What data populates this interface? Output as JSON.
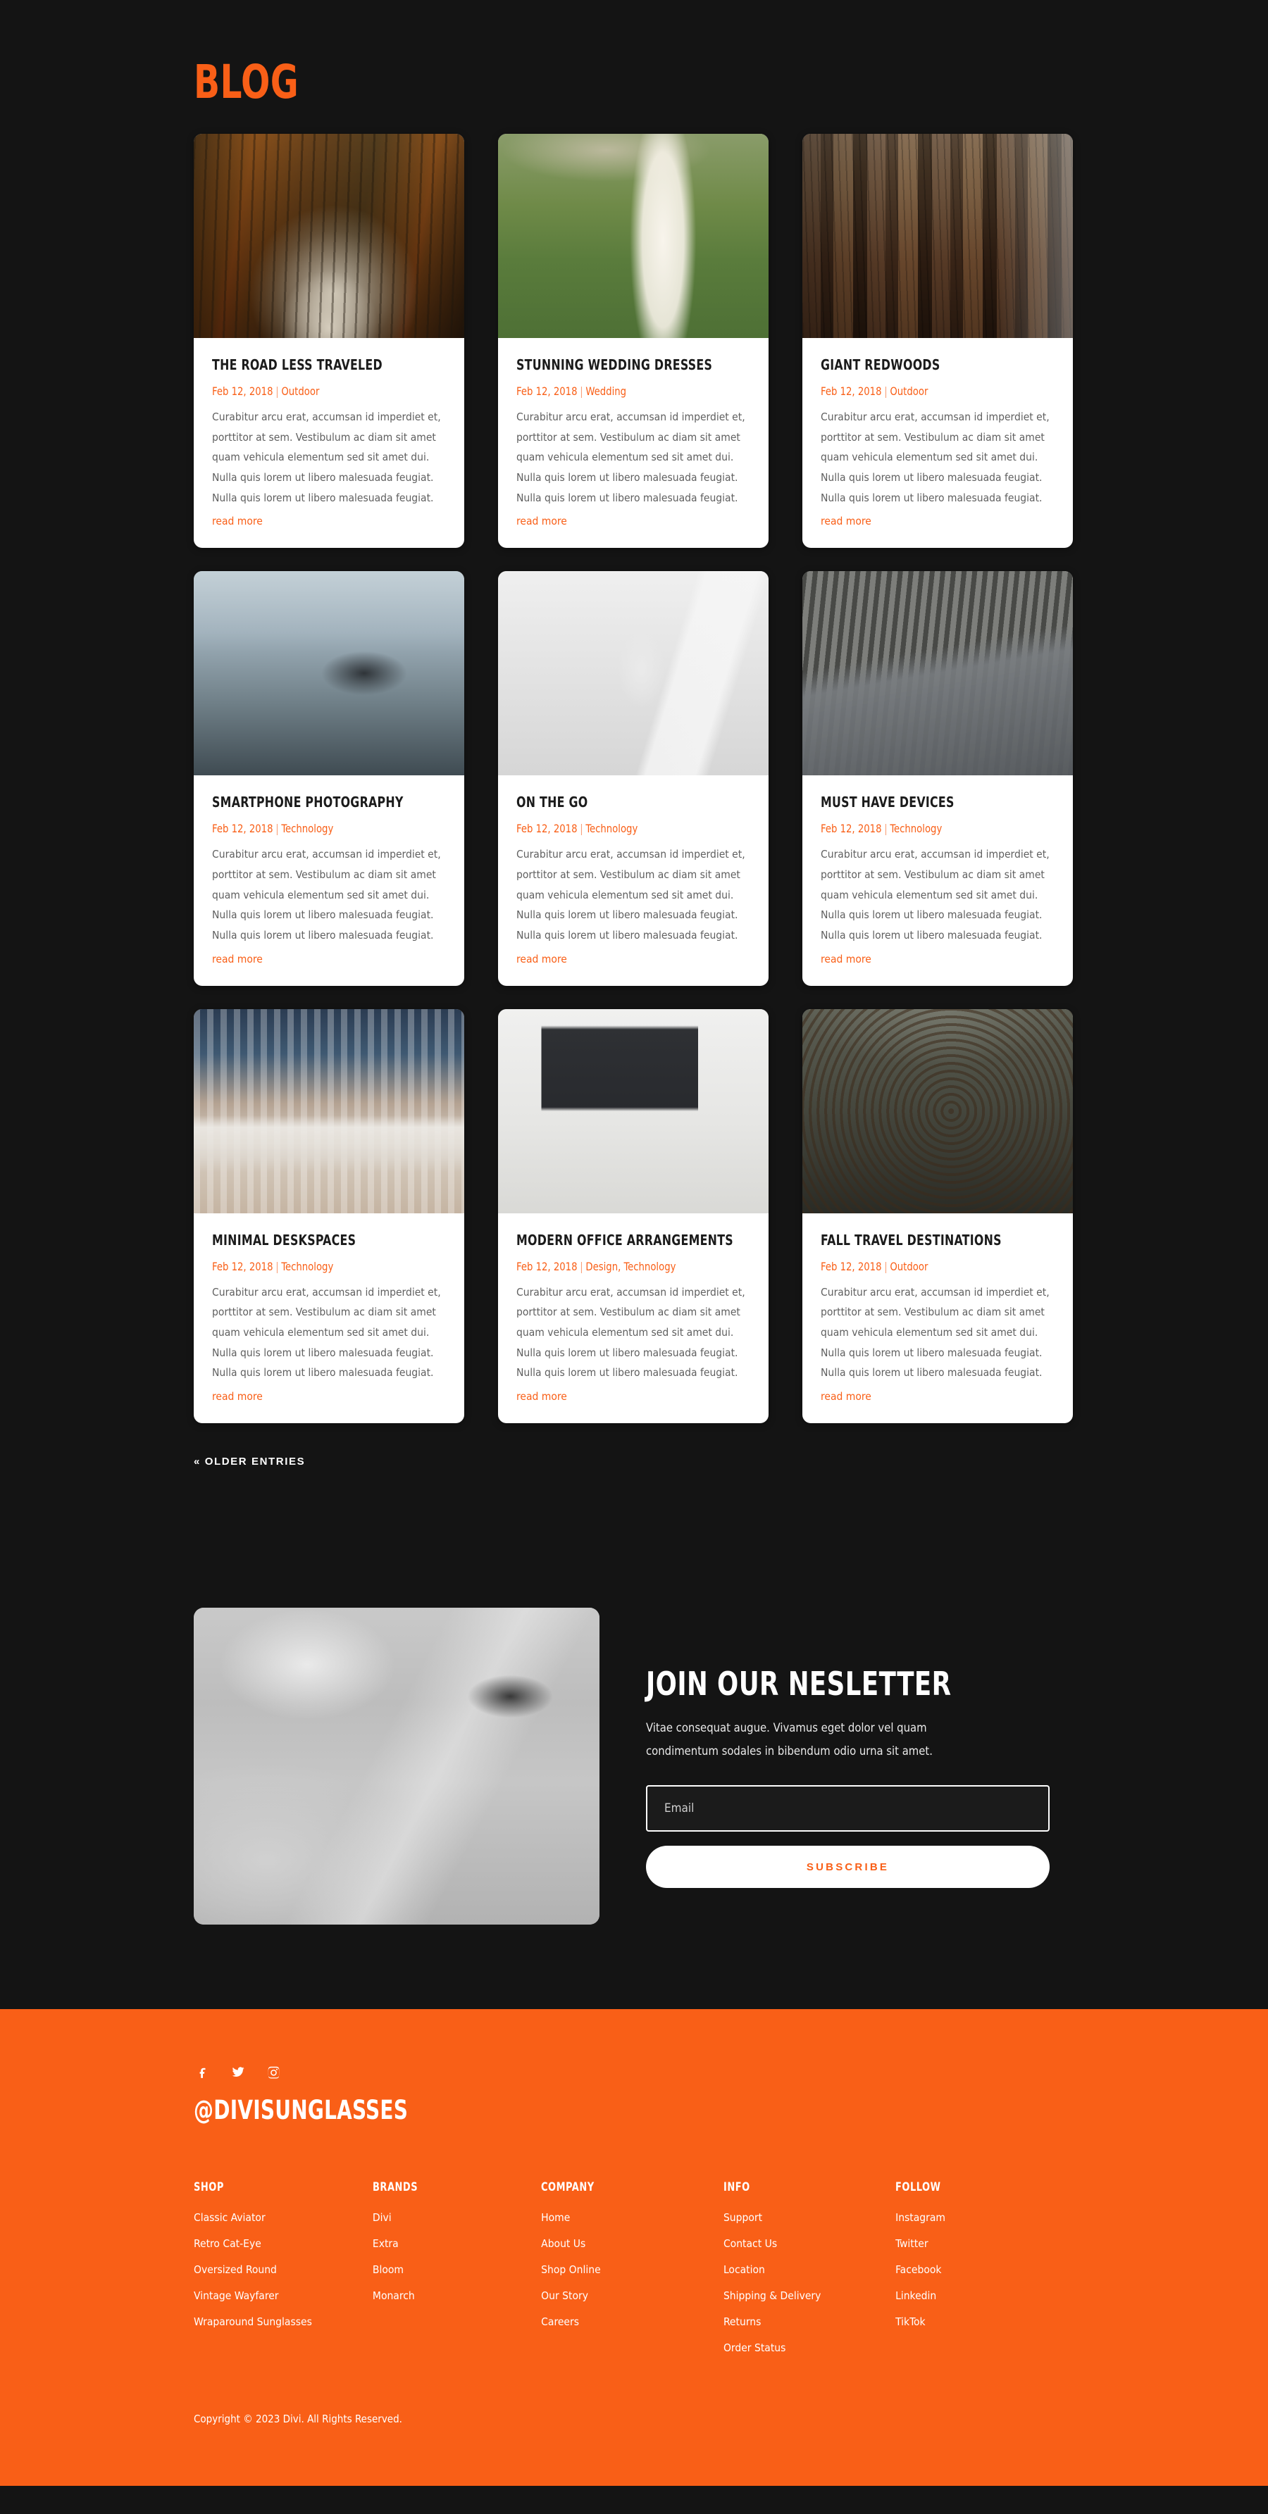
{
  "theme": {
    "accent": "#F95F17",
    "background": "#141414",
    "card_background": "#FFFFFF",
    "footer_background": "#F95F17",
    "text_light": "#FFFFFF",
    "body_text": "#5F5F5F"
  },
  "blog": {
    "title": "BLOG",
    "older_entries_label": "« OLDER ENTRIES",
    "posts": [
      {
        "title": "THE ROAD LESS TRAVELED",
        "date": "Feb 12, 2018",
        "separator": "|",
        "category": "Outdoor",
        "excerpt": "Curabitur arcu erat, accumsan id imperdiet et, porttitor at sem. Vestibulum ac diam sit amet quam vehicula elementum sed sit amet dui. Nulla quis lorem ut libero malesuada feugiat. Nulla quis lorem ut libero malesuada feugiat.",
        "read_more": "read more",
        "image": "forest-road-photo"
      },
      {
        "title": "STUNNING WEDDING DRESSES",
        "date": "Feb 12, 2018",
        "separator": "|",
        "category": "Wedding",
        "excerpt": "Curabitur arcu erat, accumsan id imperdiet et, porttitor at sem. Vestibulum ac diam sit amet quam vehicula elementum sed sit amet dui. Nulla quis lorem ut libero malesuada feugiat. Nulla quis lorem ut libero malesuada feugiat.",
        "read_more": "read more",
        "image": "bride-dress-photo"
      },
      {
        "title": "GIANT REDWOODS",
        "date": "Feb 12, 2018",
        "separator": "|",
        "category": "Outdoor",
        "excerpt": "Curabitur arcu erat, accumsan id imperdiet et, porttitor at sem. Vestibulum ac diam sit amet quam vehicula elementum sed sit amet dui. Nulla quis lorem ut libero malesuada feugiat. Nulla quis lorem ut libero malesuada feugiat.",
        "read_more": "read more",
        "image": "redwood-trees-photo"
      },
      {
        "title": "SMARTPHONE PHOTOGRAPHY",
        "date": "Feb 12, 2018",
        "separator": "|",
        "category": "Technology",
        "excerpt": "Curabitur arcu erat, accumsan id imperdiet et, porttitor at sem. Vestibulum ac diam sit amet quam vehicula elementum sed sit amet dui. Nulla quis lorem ut libero malesuada feugiat. Nulla quis lorem ut libero malesuada feugiat.",
        "read_more": "read more",
        "image": "hands-holding-phone-photo"
      },
      {
        "title": "ON THE GO",
        "date": "Feb 12, 2018",
        "separator": "|",
        "category": "Technology",
        "excerpt": "Curabitur arcu erat, accumsan id imperdiet et, porttitor at sem. Vestibulum ac diam sit amet quam vehicula elementum sed sit amet dui. Nulla quis lorem ut libero malesuada feugiat. Nulla quis lorem ut libero malesuada feugiat.",
        "read_more": "read more",
        "image": "tablet-leather-case-photo"
      },
      {
        "title": "MUST HAVE DEVICES",
        "date": "Feb 12, 2018",
        "separator": "|",
        "category": "Technology",
        "excerpt": "Curabitur arcu erat, accumsan id imperdiet et, porttitor at sem. Vestibulum ac diam sit amet quam vehicula elementum sed sit amet dui. Nulla quis lorem ut libero malesuada feugiat. Nulla quis lorem ut libero malesuada feugiat.",
        "read_more": "read more",
        "image": "laptop-keyboard-photo"
      },
      {
        "title": "MINIMAL DESKSPACES",
        "date": "Feb 12, 2018",
        "separator": "|",
        "category": "Technology",
        "excerpt": "Curabitur arcu erat, accumsan id imperdiet et, porttitor at sem. Vestibulum ac diam sit amet quam vehicula elementum sed sit amet dui. Nulla quis lorem ut libero malesuada feugiat. Nulla quis lorem ut libero malesuada feugiat.",
        "read_more": "read more",
        "image": "desk-keyboard-photo"
      },
      {
        "title": "MODERN OFFICE ARRANGEMENTS",
        "date": "Feb 12, 2018",
        "separator": "|",
        "category": "Design, Technology",
        "excerpt": "Curabitur arcu erat, accumsan id imperdiet et, porttitor at sem. Vestibulum ac diam sit amet quam vehicula elementum sed sit amet dui. Nulla quis lorem ut libero malesuada feugiat. Nulla quis lorem ut libero malesuada feugiat.",
        "read_more": "read more",
        "image": "monitor-desk-lamp-photo"
      },
      {
        "title": "FALL TRAVEL DESTINATIONS",
        "date": "Feb 12, 2018",
        "separator": "|",
        "category": "Outdoor",
        "excerpt": "Curabitur arcu erat, accumsan id imperdiet et, porttitor at sem. Vestibulum ac diam sit amet quam vehicula elementum sed sit amet dui. Nulla quis lorem ut libero malesuada feugiat. Nulla quis lorem ut libero malesuada feugiat.",
        "read_more": "read more",
        "image": "pinecone-photo"
      }
    ]
  },
  "newsletter": {
    "image": "hands-holding-sunglasses-photo",
    "heading": "JOIN OUR NESLETTER",
    "description": "Vitae consequat augue. Vivamus eget dolor vel quam condimentum sodales in bibendum odio urna sit amet.",
    "email_placeholder": "Email",
    "email_value": "",
    "subscribe_label": "SUBSCRIBE"
  },
  "footer": {
    "socials": [
      {
        "name": "facebook",
        "label": "Facebook"
      },
      {
        "name": "twitter",
        "label": "Twitter"
      },
      {
        "name": "instagram",
        "label": "Instagram"
      }
    ],
    "brand_handle": "@DIVISUNGLASSES",
    "columns": [
      {
        "title": "SHOP",
        "links": [
          "Classic Aviator",
          "Retro Cat-Eye",
          "Oversized Round",
          "Vintage Wayfarer",
          "Wraparound Sunglasses"
        ]
      },
      {
        "title": "BRANDS",
        "links": [
          "Divi",
          "Extra",
          "Bloom",
          "Monarch"
        ]
      },
      {
        "title": "COMPANY",
        "links": [
          "Home",
          "About Us",
          "Shop Online",
          "Our Story",
          "Careers"
        ]
      },
      {
        "title": "INFO",
        "links": [
          "Support",
          "Contact Us",
          "Location",
          "Shipping & Delivery",
          "Returns",
          "Order Status"
        ]
      },
      {
        "title": "FOLLOW",
        "links": [
          "Instagram",
          "Twitter",
          "Facebook",
          "Linkedin",
          "TikTok"
        ]
      }
    ],
    "copyright": "Copyright © 2023 Divi. All Rights Reserved."
  }
}
